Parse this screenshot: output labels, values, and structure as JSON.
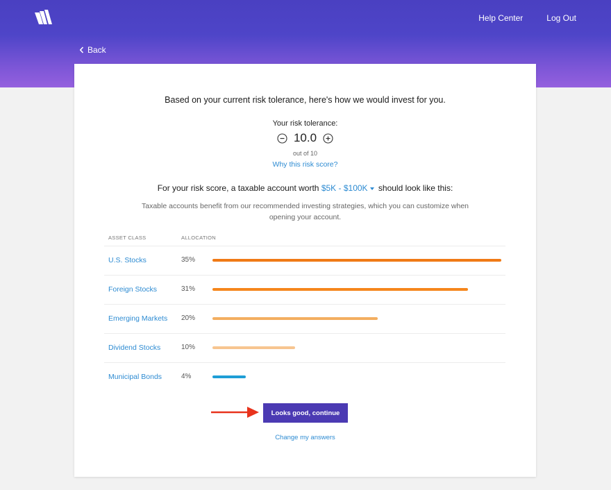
{
  "header": {
    "logo_name": "w-logo-icon",
    "nav": [
      {
        "label": "Help Center"
      },
      {
        "label": "Log Out"
      }
    ],
    "back_label": "Back"
  },
  "card": {
    "headline": "Based on your current risk tolerance, here's how we would invest for you.",
    "risk_label": "Your risk tolerance:",
    "risk_value": "10.0",
    "risk_out_of": "out of 10",
    "why_link": "Why this risk score?",
    "sentence_pre": "For your risk score, a taxable account worth",
    "range_value": "$5K - $100K",
    "sentence_post": "should look like this:",
    "description": "Taxable accounts benefit from our recommended investing strategies, which you can customize when opening your account.",
    "table": {
      "headers": [
        "Asset Class",
        "Allocation"
      ],
      "rows": [
        {
          "name": "U.S. Stocks",
          "pct": "35%",
          "value": 35,
          "color": "#f07a16"
        },
        {
          "name": "Foreign Stocks",
          "pct": "31%",
          "value": 31,
          "color": "#f5861c"
        },
        {
          "name": "Emerging Markets",
          "pct": "20%",
          "value": 20,
          "color": "#f3ae60"
        },
        {
          "name": "Dividend Stocks",
          "pct": "10%",
          "value": 10,
          "color": "#f7c590"
        },
        {
          "name": "Municipal Bonds",
          "pct": "4%",
          "value": 4,
          "color": "#1e9ed6"
        }
      ]
    },
    "cta_label": "Looks good, continue",
    "change_link": "Change my answers"
  },
  "colors": {
    "brand": "#4b3ab3",
    "link": "#2d8bd2",
    "arrow": "#e8331c"
  }
}
